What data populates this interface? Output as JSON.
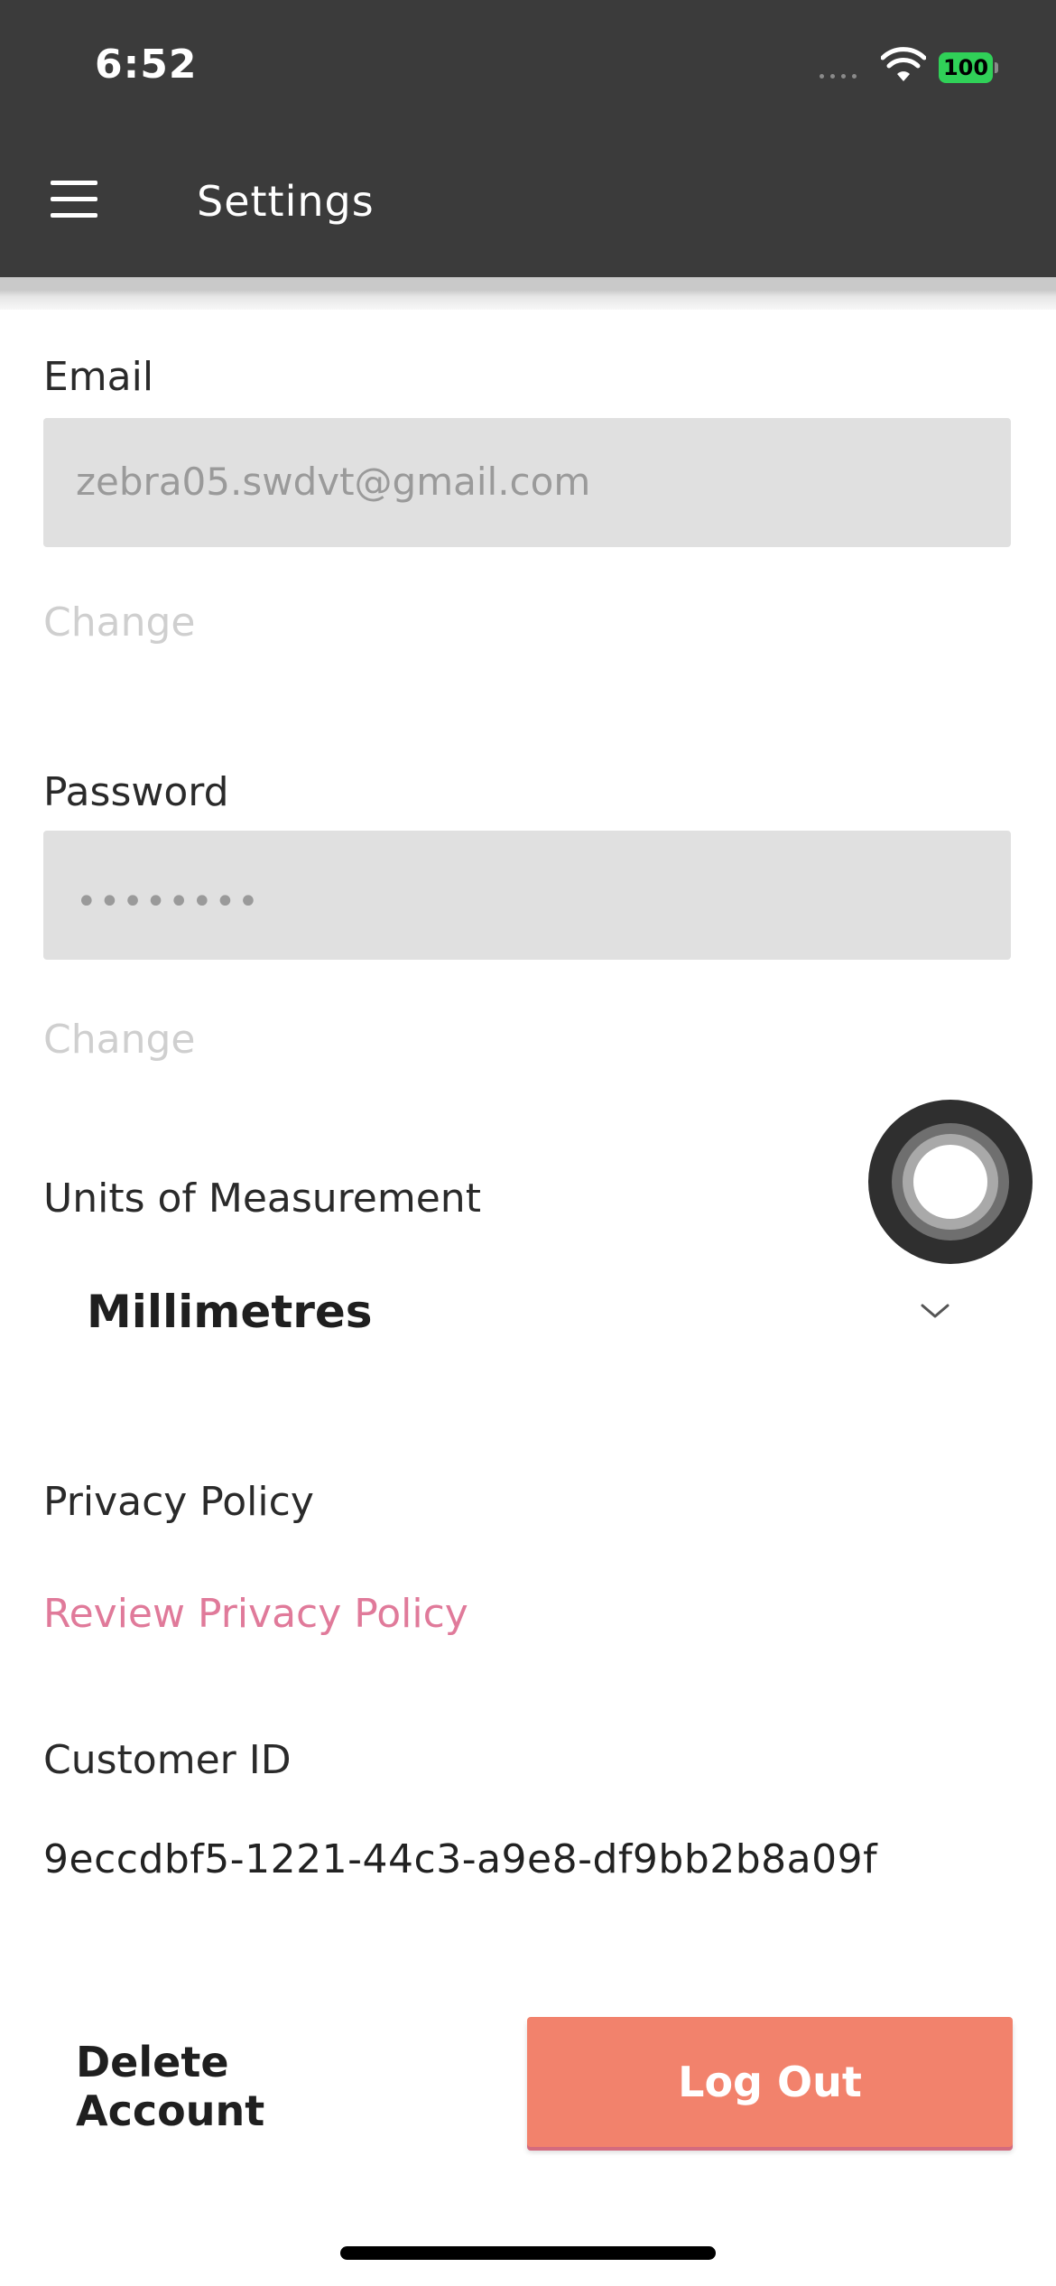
{
  "status_bar": {
    "time": "6:52",
    "battery_level": "100",
    "battery_color": "#30d158"
  },
  "header": {
    "menu_icon": "hamburger-menu-icon",
    "title": "Settings",
    "background_color": "#3b3b3b"
  },
  "email": {
    "label": "Email",
    "value": "zebra05.swdvt@gmail.com",
    "change_label": "Change"
  },
  "password": {
    "label": "Password",
    "value": "••••••••",
    "change_label": "Change"
  },
  "units": {
    "label": "Units of Measurement",
    "selected": "Millimetres",
    "icon": "chevron-down-icon"
  },
  "privacy": {
    "label": "Privacy Policy",
    "link_label": "Review Privacy Policy",
    "link_color": "#e07a9a"
  },
  "customer": {
    "label": "Customer ID",
    "id": "9eccdbf5-1221-44c3-a9e8-df9bb2b8a09f"
  },
  "actions": {
    "delete_label": "Delete Account",
    "logout_label": "Log Out",
    "logout_color": "#f2826c"
  }
}
